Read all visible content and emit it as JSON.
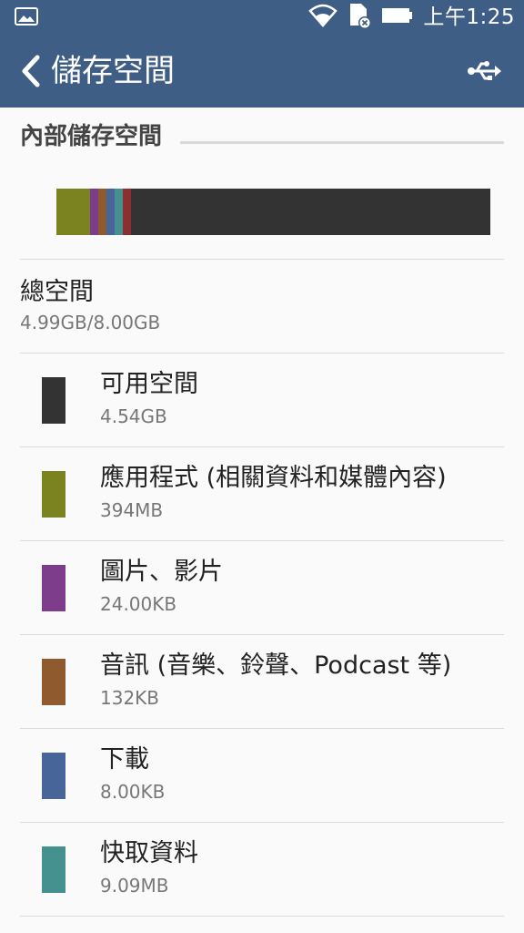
{
  "status_bar": {
    "time": "上午1:25",
    "icons": [
      "image-notification-icon",
      "wifi-icon",
      "sd-card-error-icon",
      "battery-icon"
    ]
  },
  "app_bar": {
    "title": "儲存空間",
    "back_icon": "chevron-left-icon",
    "usb_icon": "usb-icon"
  },
  "section": {
    "header": "內部儲存空間"
  },
  "usage_bar": {
    "segments": [
      {
        "name": "apps",
        "fraction": 0.077,
        "color": "#7b8320"
      },
      {
        "name": "pictures",
        "fraction": 0.019,
        "color": "#7d3d8a"
      },
      {
        "name": "audio",
        "fraction": 0.019,
        "color": "#8f5a2e"
      },
      {
        "name": "downloads",
        "fraction": 0.019,
        "color": "#48659a"
      },
      {
        "name": "cache",
        "fraction": 0.019,
        "color": "#45918f"
      },
      {
        "name": "misc",
        "fraction": 0.019,
        "color": "#8b2f2f"
      },
      {
        "name": "available",
        "fraction": 0.828,
        "color": "#333333"
      }
    ]
  },
  "total": {
    "label": "總空間",
    "value": "4.99GB/8.00GB"
  },
  "categories": [
    {
      "label": "可用空間",
      "size": "4.54GB",
      "color": "#333333"
    },
    {
      "label": "應用程式 (相關資料和媒體內容)",
      "size": "394MB",
      "color": "#7b8320"
    },
    {
      "label": "圖片、影片",
      "size": "24.00KB",
      "color": "#7d3d8a"
    },
    {
      "label": "音訊 (音樂、鈴聲、Podcast 等)",
      "size": "132KB",
      "color": "#8f5a2e"
    },
    {
      "label": "下載",
      "size": "8.00KB",
      "color": "#48659a"
    },
    {
      "label": "快取資料",
      "size": "9.09MB",
      "color": "#45918f"
    }
  ],
  "colors": {
    "primary": "#3f5e86",
    "background": "#fafafa"
  }
}
